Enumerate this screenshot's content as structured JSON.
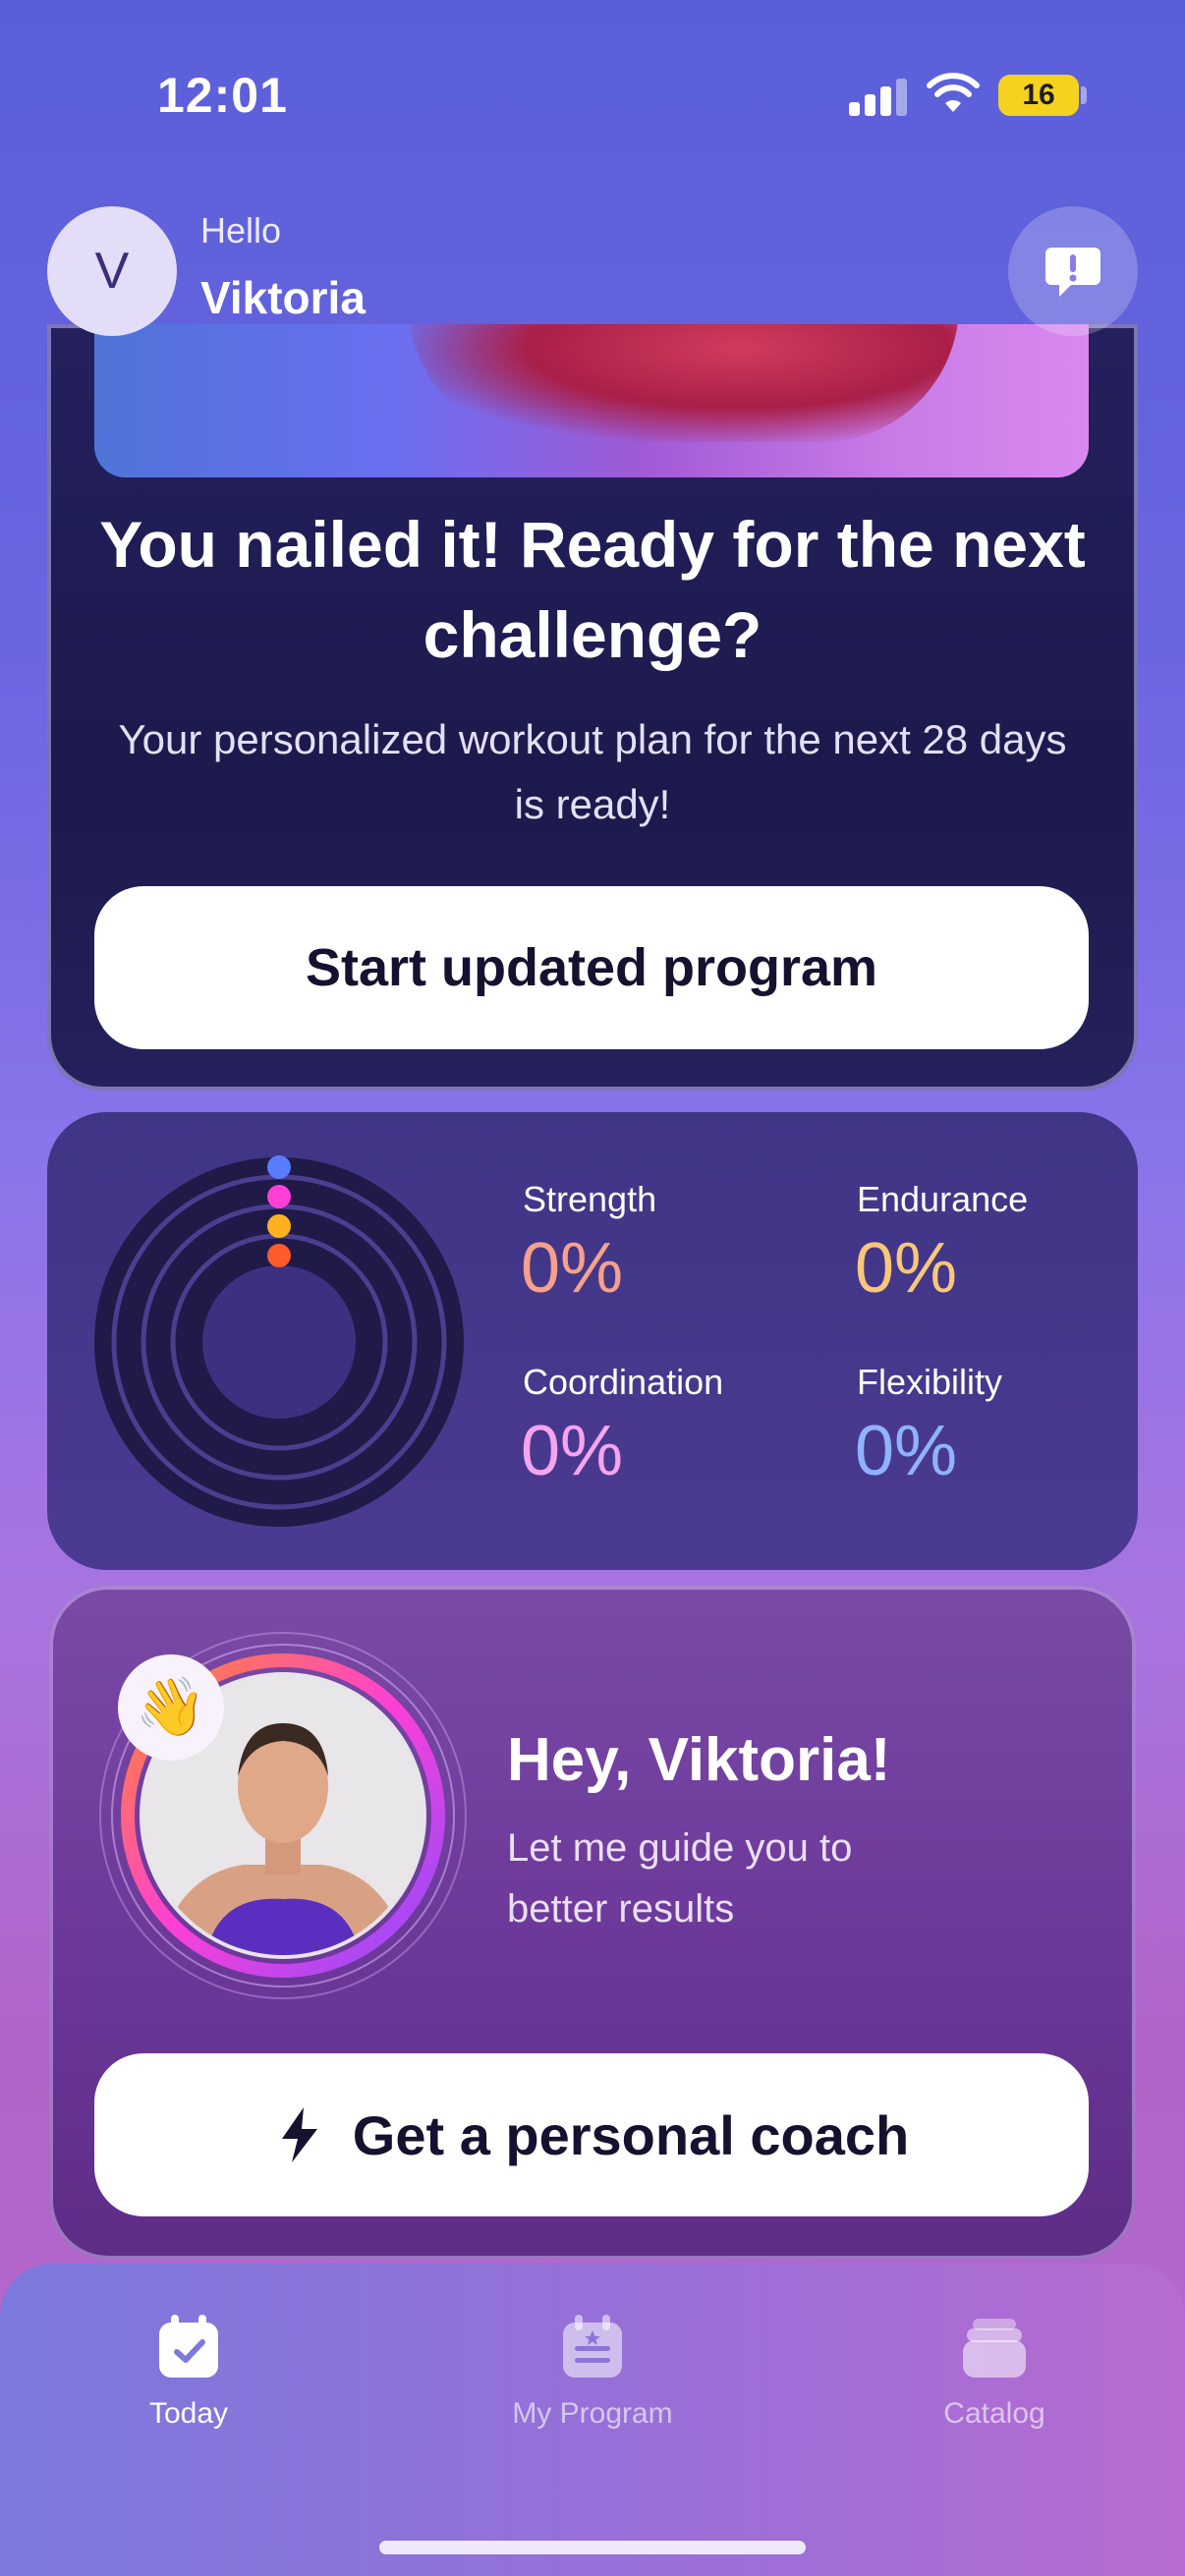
{
  "status_bar": {
    "time": "12:01",
    "battery": "16"
  },
  "header": {
    "avatar_initial": "V",
    "greeting": "Hello",
    "username": "Viktoria"
  },
  "promo": {
    "title": "You nailed it! Ready for the next challenge?",
    "subtitle": "Your personalized workout plan for the next 28 days is ready!",
    "button_label": "Start updated program"
  },
  "stats": {
    "items": [
      {
        "label": "Strength",
        "value": "0%",
        "color": "#f7a08a"
      },
      {
        "label": "Endurance",
        "value": "0%",
        "color": "#f9c67a"
      },
      {
        "label": "Coordination",
        "value": "0%",
        "color": "#f6a4ef"
      },
      {
        "label": "Flexibility",
        "value": "0%",
        "color": "#8fb3ff"
      }
    ]
  },
  "coach": {
    "title": "Hey, Viktoria!",
    "subtitle": "Let me guide you to better results",
    "button_label": "Get a personal coach",
    "emoji": "👋"
  },
  "tabs": [
    {
      "label": "Today",
      "active": true,
      "icon": "calendar-check-icon"
    },
    {
      "label": "My Program",
      "active": false,
      "icon": "program-calendar-icon"
    },
    {
      "label": "Catalog",
      "active": false,
      "icon": "catalog-stack-icon"
    }
  ]
}
